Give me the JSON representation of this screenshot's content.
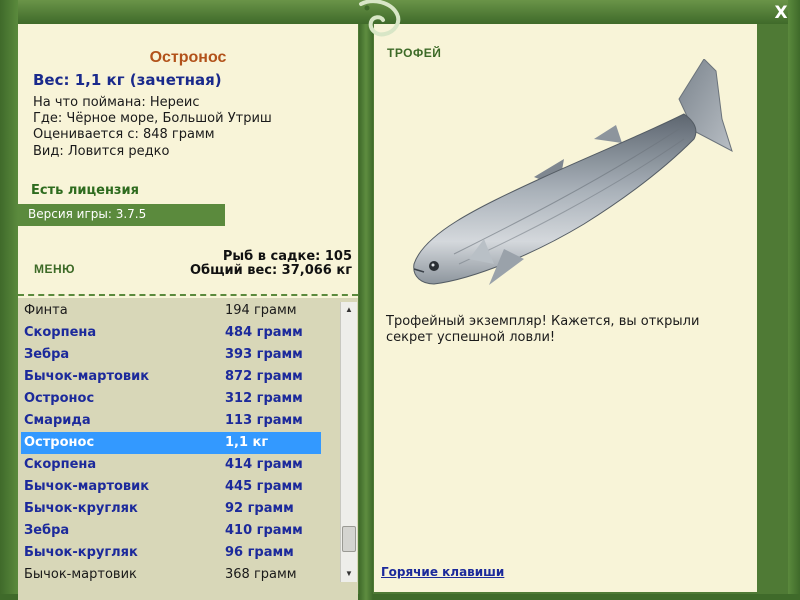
{
  "window": {
    "close_glyph": "X"
  },
  "fish": {
    "name": "Остронос",
    "weight_line": "Вес: 1,1 кг (зачетная)",
    "caught_on": "На что поймана: Нереис",
    "location": "Где: Чёрное море, Большой Утриш",
    "rated_from": "Оценивается с: 848 грамм",
    "kind": "Вид: Ловится редко"
  },
  "license": "Есть лицензия",
  "version": "Версия игры: 3.7.5",
  "menu_label": "МЕНЮ",
  "stats": {
    "fish_count": "Рыб в садке: 105",
    "total_weight": "Общий вес: 37,066 кг"
  },
  "catch_list": [
    {
      "name": "Финта",
      "weight": "194 грамм",
      "style": "normal"
    },
    {
      "name": "Скорпена",
      "weight": "484 грамм",
      "style": "bold"
    },
    {
      "name": "Зебра",
      "weight": "393 грамм",
      "style": "bold"
    },
    {
      "name": "Бычок-мартовик",
      "weight": "872 грамм",
      "style": "bold"
    },
    {
      "name": "Остронос",
      "weight": "312 грамм",
      "style": "bold"
    },
    {
      "name": "Смарида",
      "weight": "113 грамм",
      "style": "bold"
    },
    {
      "name": "Остронос",
      "weight": "1,1 кг",
      "style": "selected"
    },
    {
      "name": "Скорпена",
      "weight": "414 грамм",
      "style": "bold"
    },
    {
      "name": "Бычок-мартовик",
      "weight": "445 грамм",
      "style": "bold"
    },
    {
      "name": "Бычок-кругляк",
      "weight": "92 грамм",
      "style": "bold"
    },
    {
      "name": "Зебра",
      "weight": "410 грамм",
      "style": "bold"
    },
    {
      "name": "Бычок-кругляк",
      "weight": "96 грамм",
      "style": "bold"
    },
    {
      "name": "Бычок-мартовик",
      "weight": "368 грамм",
      "style": "normal"
    }
  ],
  "trophy": {
    "title": "ТРОФЕЙ",
    "message": "Трофейный экземпляр! Кажется, вы открыли секрет успешной ловли!",
    "image_icon": "mullet-fish-image"
  },
  "hotkeys_label": "Горячие клавиши",
  "colors": {
    "frame_green": "#4f7a35",
    "panel_bg": "#f8f4d8",
    "fish_name": "#b2521a",
    "list_bold": "#1c2a9b",
    "selected_row": "#3399ff"
  }
}
